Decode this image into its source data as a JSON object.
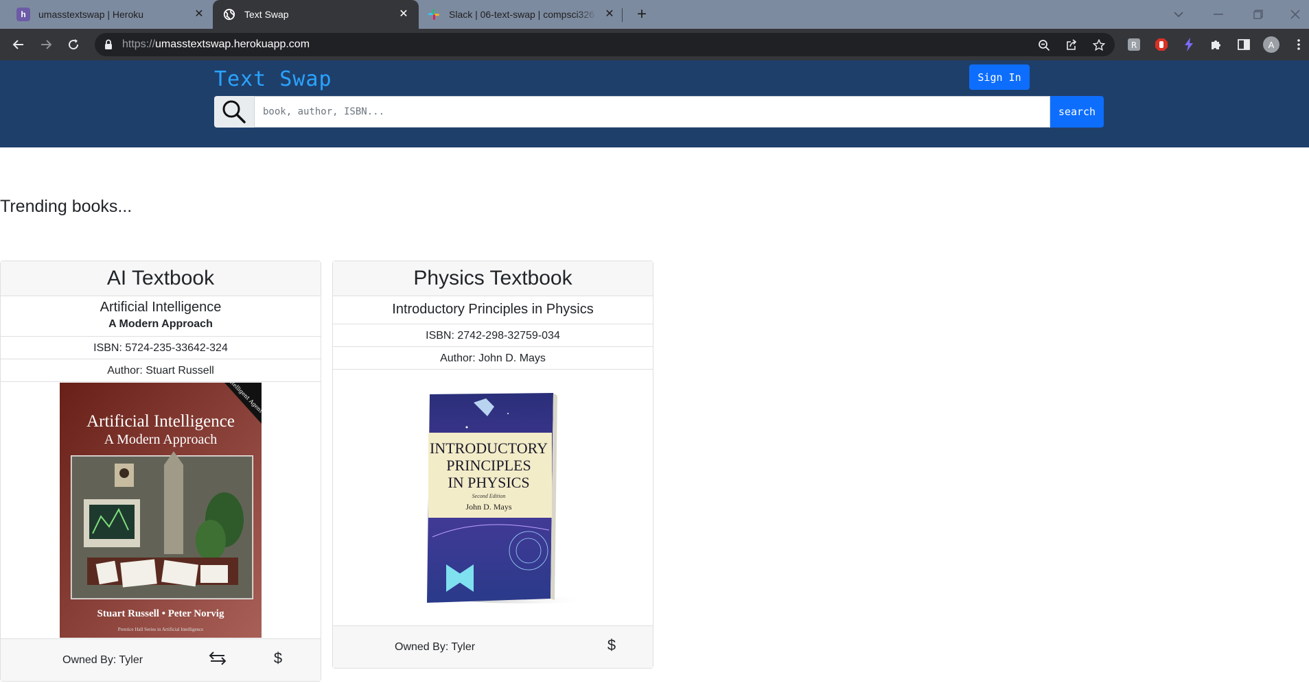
{
  "browser": {
    "tabs": [
      {
        "title": "umasstextswap | Heroku",
        "favicon": "heroku-icon"
      },
      {
        "title": "Text Swap",
        "favicon": "globe-icon",
        "active": true
      },
      {
        "title": "Slack | 06-text-swap | compsci326",
        "favicon": "slack-icon"
      }
    ],
    "url_scheme": "https://",
    "url_host": "umasstextswap.herokuapp.com",
    "profile_initial": "A"
  },
  "header": {
    "brand": "Text Swap",
    "signin_label": "Sign In",
    "search_placeholder": "book, author, ISBN...",
    "search_button": "search",
    "background": "#1f3f6b",
    "accent": "#0d6efd"
  },
  "main": {
    "section_title": "Trending books...",
    "cards": [
      {
        "category": "AI Textbook",
        "title": "Artificial Intelligence",
        "subtitle": "A Modern Approach",
        "isbn": "ISBN: 5724-235-33642-324",
        "author": "Author: Stuart Russell",
        "owner": "Owned By: Tyler",
        "cover": {
          "title_line1": "Artificial Intelligence",
          "title_line2": "A Modern Approach",
          "authors": "Stuart Russell • Peter Norvig",
          "series": "Prentice Hall Series in Artificial Intelligence",
          "banner": "The Intelligent Agent Book"
        },
        "actions": [
          "swap-icon",
          "dollar-icon"
        ]
      },
      {
        "category": "Physics Textbook",
        "title": "Introductory Principles in Physics",
        "isbn": "ISBN: 2742-298-32759-034",
        "author": "Author: John D. Mays",
        "owner": "Owned By: Tyler",
        "cover": {
          "title_line1": "INTRODUCTORY",
          "title_line2": "PRINCIPLES",
          "title_line3": "IN PHYSICS",
          "edition": "Second Edition",
          "author": "John D. Mays"
        },
        "actions": [
          "dollar-icon"
        ]
      }
    ]
  }
}
